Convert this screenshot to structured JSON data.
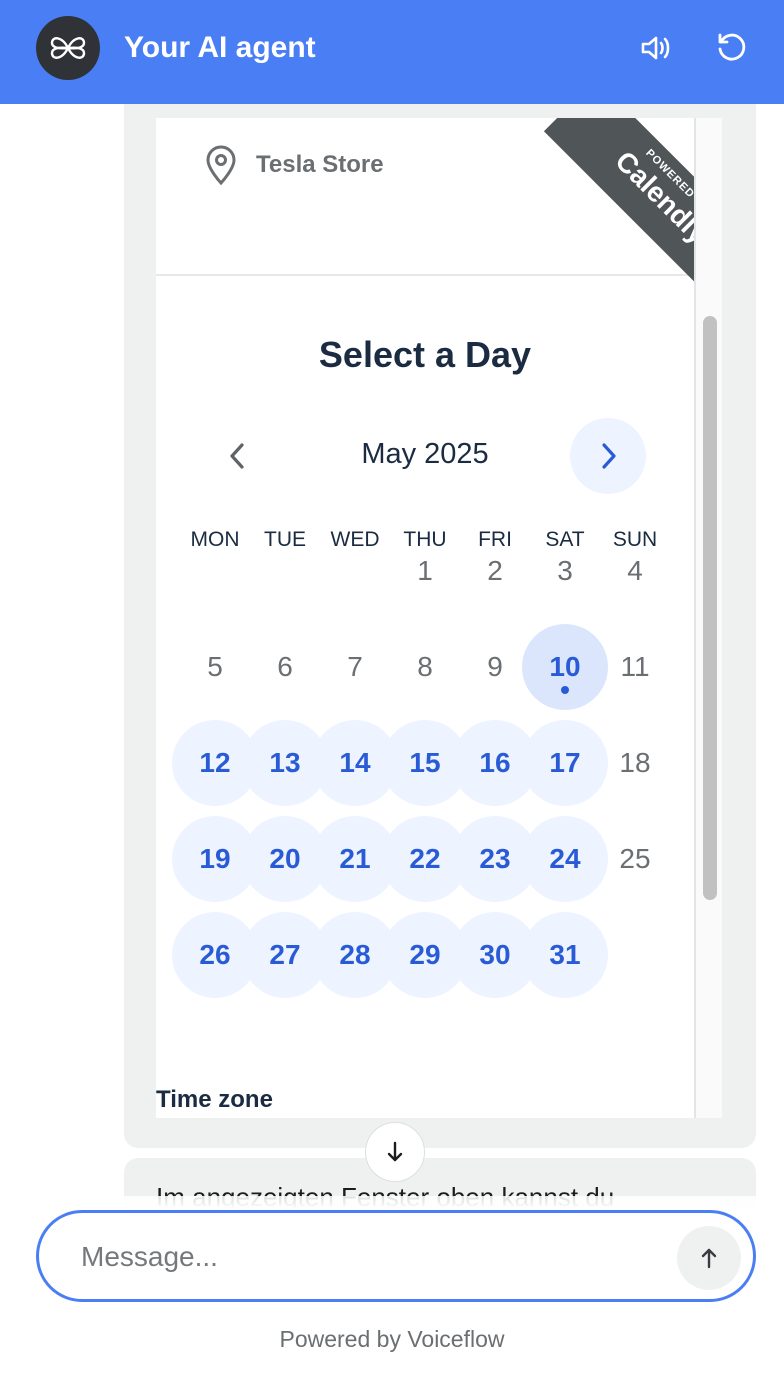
{
  "header": {
    "title": "Your AI agent",
    "avatar_icon": "butterfly-logo-icon",
    "sound_icon": "speaker-icon",
    "restart_icon": "restart-icon",
    "color": "#4a7ef5"
  },
  "calendly": {
    "location": "Tesla Store",
    "location_icon": "map-pin-icon",
    "ribbon_small": "POWERED BY",
    "ribbon_big": "Calendly",
    "title": "Select a Day",
    "month": "May 2025",
    "weekdays": [
      "MON",
      "TUE",
      "WED",
      "THU",
      "FRI",
      "SAT",
      "SUN"
    ],
    "days": [
      {
        "label": "1",
        "state": "off"
      },
      {
        "label": "2",
        "state": "off"
      },
      {
        "label": "3",
        "state": "off"
      },
      {
        "label": "4",
        "state": "off"
      },
      {
        "label": "5",
        "state": "off"
      },
      {
        "label": "6",
        "state": "off"
      },
      {
        "label": "7",
        "state": "off"
      },
      {
        "label": "8",
        "state": "off"
      },
      {
        "label": "9",
        "state": "off"
      },
      {
        "label": "10",
        "state": "today"
      },
      {
        "label": "11",
        "state": "off"
      },
      {
        "label": "12",
        "state": "available"
      },
      {
        "label": "13",
        "state": "available"
      },
      {
        "label": "14",
        "state": "available"
      },
      {
        "label": "15",
        "state": "available"
      },
      {
        "label": "16",
        "state": "available"
      },
      {
        "label": "17",
        "state": "available"
      },
      {
        "label": "18",
        "state": "off"
      },
      {
        "label": "19",
        "state": "available"
      },
      {
        "label": "20",
        "state": "available"
      },
      {
        "label": "21",
        "state": "available"
      },
      {
        "label": "22",
        "state": "available"
      },
      {
        "label": "23",
        "state": "available"
      },
      {
        "label": "24",
        "state": "available"
      },
      {
        "label": "25",
        "state": "off"
      },
      {
        "label": "26",
        "state": "available"
      },
      {
        "label": "27",
        "state": "available"
      },
      {
        "label": "28",
        "state": "available"
      },
      {
        "label": "29",
        "state": "available"
      },
      {
        "label": "30",
        "state": "available"
      },
      {
        "label": "31",
        "state": "available"
      }
    ],
    "first_weekday_index": 3,
    "timezone_label": "Time zone",
    "accent": "#2a5bd7"
  },
  "messages": {
    "second_text": "Im angezeigten Fenster oben kannst du"
  },
  "composer": {
    "placeholder": "Message...",
    "value": "",
    "send_icon": "arrow-up-icon",
    "scroll_down_icon": "arrow-down-icon",
    "powered_by": "Powered by Voiceflow"
  }
}
